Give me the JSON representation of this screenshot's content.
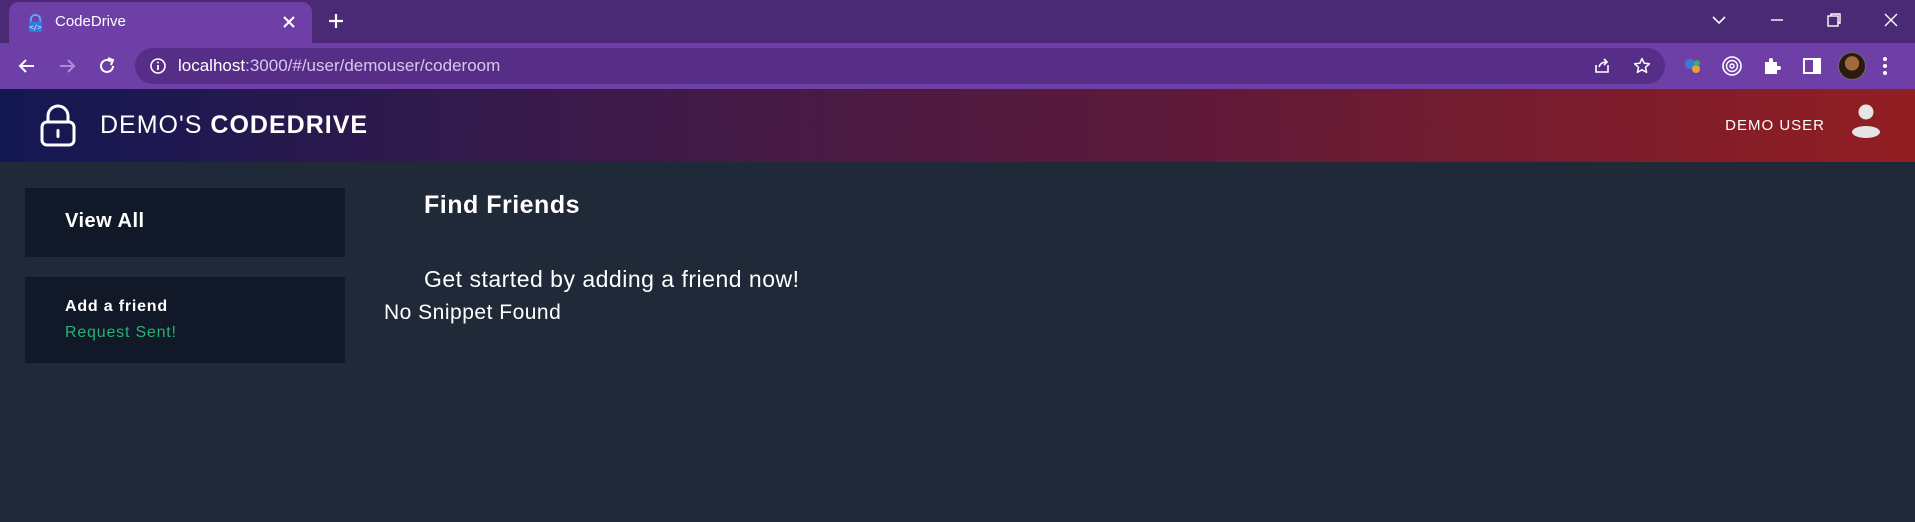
{
  "browser": {
    "tab_title": "CodeDrive",
    "url_host": "localhost",
    "url_rest": ":3000/#/user/demouser/coderoom"
  },
  "header": {
    "brand_prefix": "DEMO'S",
    "brand_name": "CODEDRIVE",
    "user_label": "DEMO USER"
  },
  "sidebar": {
    "view_all_label": "View All",
    "friend": {
      "title": "Add a friend",
      "status": "Request Sent!"
    }
  },
  "main": {
    "title": "Find Friends",
    "subtitle": "Get started by adding a friend now!",
    "empty_text": "No Snippet Found"
  },
  "colors": {
    "page_bg": "#1f2937",
    "card_bg": "#111827",
    "status_green": "#22b573",
    "chrome_purple": "#6f3fa8"
  }
}
